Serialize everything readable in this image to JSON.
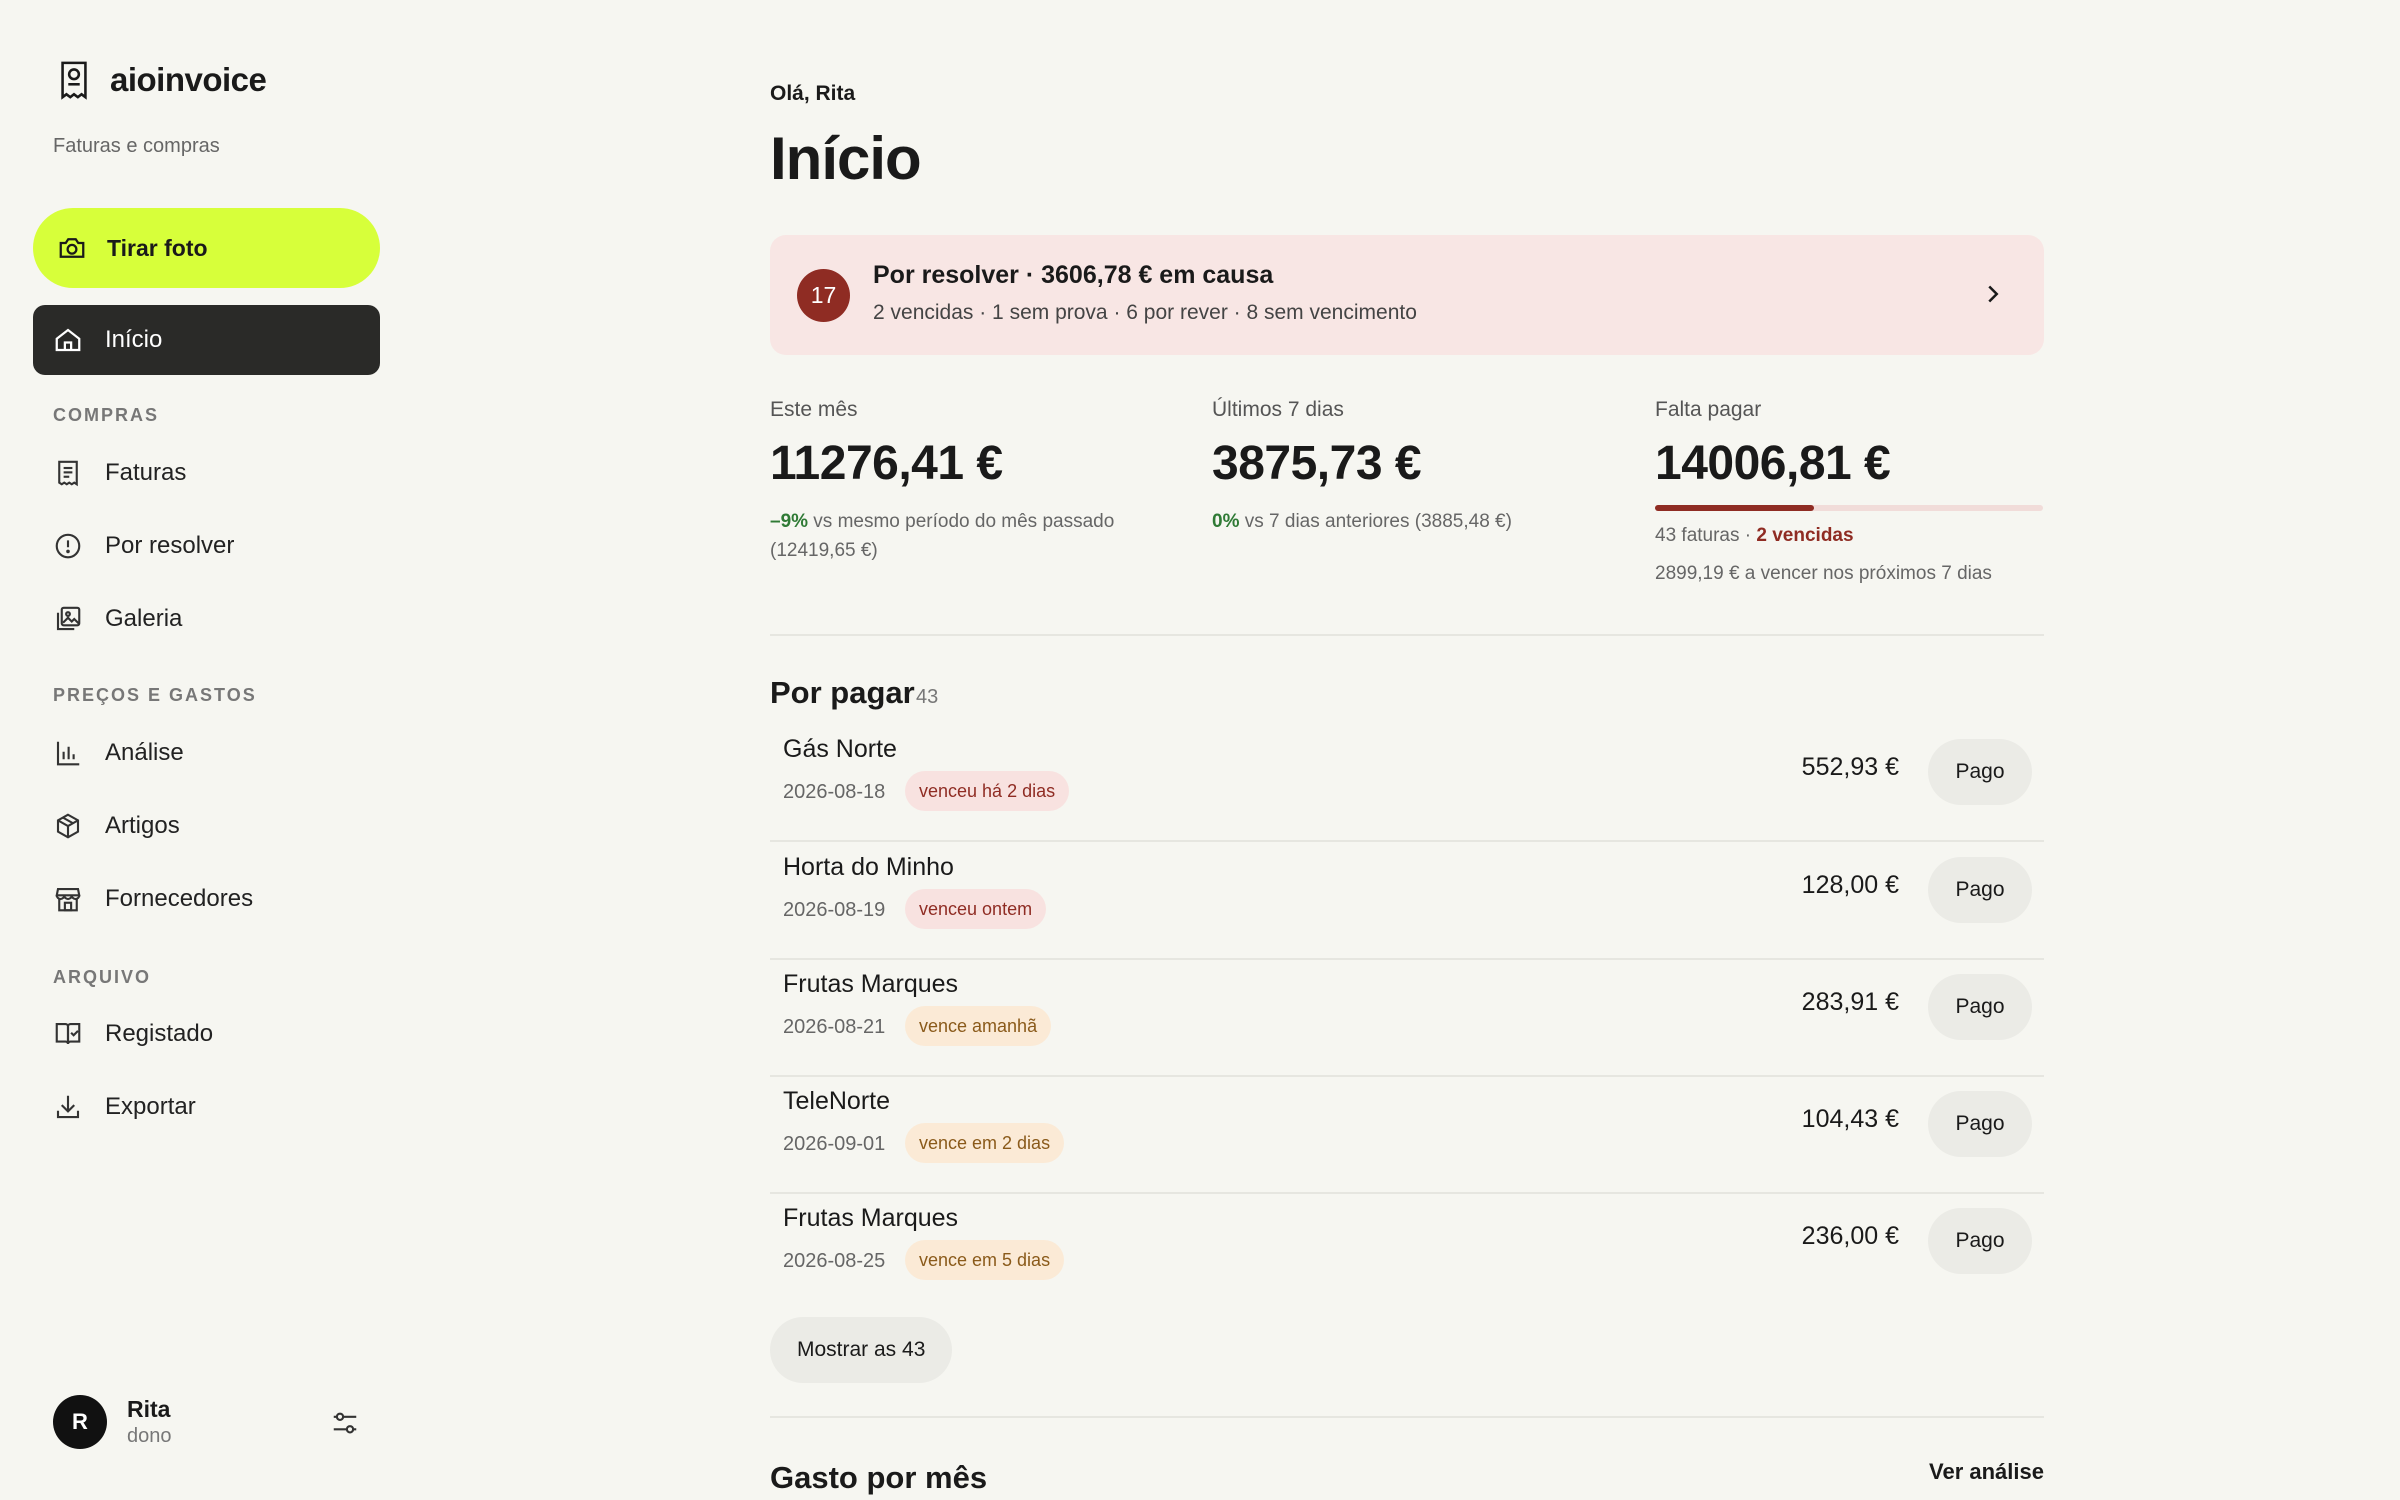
{
  "brand": {
    "name": "aioinvoice",
    "subtitle": "Faturas e compras",
    "icon": "receipt-icon"
  },
  "sidebar": {
    "photo_button": "Tirar foto",
    "active_item": "Início",
    "sections": [
      {
        "label": "COMPRAS",
        "items": [
          {
            "label": "Faturas",
            "icon": "document-icon"
          },
          {
            "label": "Por resolver",
            "icon": "alert-circle-icon"
          },
          {
            "label": "Galeria",
            "icon": "gallery-icon"
          }
        ]
      },
      {
        "label": "PREÇOS E GASTOS",
        "items": [
          {
            "label": "Análise",
            "icon": "bar-chart-icon"
          },
          {
            "label": "Artigos",
            "icon": "box-icon"
          },
          {
            "label": "Fornecedores",
            "icon": "store-icon"
          }
        ]
      },
      {
        "label": "ARQUIVO",
        "items": [
          {
            "label": "Registado",
            "icon": "book-check-icon"
          },
          {
            "label": "Exportar",
            "icon": "download-icon"
          }
        ]
      }
    ],
    "user": {
      "initial": "R",
      "name": "Rita",
      "role": "dono"
    }
  },
  "header": {
    "greeting": "Olá, Rita",
    "title": "Início"
  },
  "alert": {
    "count": "17",
    "title": "Por resolver · 3606,78 € em causa",
    "subtitle": "2 vencidas · 1 sem prova · 6 por rever · 8 sem vencimento"
  },
  "stats": {
    "month": {
      "label": "Este mês",
      "value": "11276,41 €",
      "delta": "–9%",
      "compare_line1": " vs mesmo período do mês passado",
      "compare_line2": "(12419,65 €)"
    },
    "week": {
      "label": "Últimos 7 dias",
      "value": "3875,73 €",
      "delta": "0%",
      "compare": " vs 7 dias anteriores (3885,48 €)"
    },
    "due": {
      "label": "Falta pagar",
      "value": "14006,81 €",
      "progress_fraction": 0.41,
      "invoices": "43 faturas · ",
      "overdue": "2 vencidas",
      "upcoming": "2899,19 € a vencer nos próximos 7 dias"
    }
  },
  "to_pay": {
    "title": "Por pagar",
    "count": "43",
    "button_label": "Pago",
    "rows": [
      {
        "name": "Gás Norte",
        "date": "2026-08-18",
        "tag": "venceu há 2 dias",
        "tag_kind": "red",
        "amount": "552,93 €"
      },
      {
        "name": "Horta do Minho",
        "date": "2026-08-19",
        "tag": "venceu ontem",
        "tag_kind": "red",
        "amount": "128,00 €"
      },
      {
        "name": "Frutas Marques",
        "date": "2026-08-21",
        "tag": "vence amanhã",
        "tag_kind": "amber",
        "amount": "283,91 €"
      },
      {
        "name": "TeleNorte",
        "date": "2026-09-01",
        "tag": "vence em 2 dias",
        "tag_kind": "amber",
        "amount": "104,43 €"
      },
      {
        "name": "Frutas Marques",
        "date": "2026-08-25",
        "tag": "vence em 5 dias",
        "tag_kind": "amber",
        "amount": "236,00 €"
      }
    ],
    "show_more": "Mostrar as 43"
  },
  "monthly": {
    "title": "Gasto por mês",
    "link": "Ver análise"
  },
  "colors": {
    "accent": "#d7ff3a",
    "danger": "#8f2c23",
    "positive": "#2f7a35",
    "dark": "#2a2a28"
  }
}
